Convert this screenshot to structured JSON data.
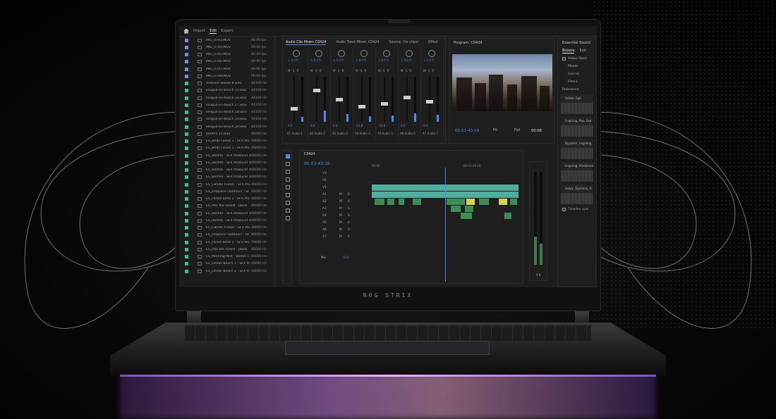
{
  "nav": {
    "import": "Import",
    "edit": "Edit",
    "export": "Export"
  },
  "project_items": [
    {
      "name": "IMG_0743.MOV",
      "rate": "60.00 fps",
      "color": "#7b8bd4",
      "kind": "video"
    },
    {
      "name": "IMG_0744.MOV",
      "rate": "60.00 fps",
      "color": "#7b8bd4",
      "kind": "video"
    },
    {
      "name": "IMG_0745.MOV",
      "rate": "60.00 fps",
      "color": "#7b8bd4",
      "kind": "video"
    },
    {
      "name": "IMG_0746.MOV",
      "rate": "60.00 fps",
      "color": "#7b8bd4",
      "kind": "video"
    },
    {
      "name": "IMG_0747.MOV",
      "rate": "60.00 fps",
      "color": "#7b8bd4",
      "kind": "video"
    },
    {
      "name": "IMG_0748.MOV",
      "rate": "60.00 fps",
      "color": "#7b8bd4",
      "kind": "video"
    },
    {
      "name": "ambient waves 8.wav",
      "rate": "44100 Hz",
      "color": "#37c08a",
      "kind": "audio"
    },
    {
      "name": "seagull-on-beach 15.wav",
      "rate": "44100 Hz",
      "color": "#37c08a",
      "kind": "audio"
    },
    {
      "name": "seagull-on-beach 16.wav",
      "rate": "44100 Hz",
      "color": "#37c08a",
      "kind": "audio"
    },
    {
      "name": "seagull-on-beach 17.wav",
      "rate": "44100 Hz",
      "color": "#37c08a",
      "kind": "audio"
    },
    {
      "name": "seagull-on-beach 18.wav",
      "rate": "44100 Hz",
      "color": "#37c08a",
      "kind": "audio"
    },
    {
      "name": "seagull-on-beach 19.wav",
      "rate": "44100 Hz",
      "color": "#37c08a",
      "kind": "audio"
    },
    {
      "name": "seagull-on-beach 20.wav",
      "rate": "44100 Hz",
      "color": "#37c08a",
      "kind": "audio"
    },
    {
      "name": "bonfire 12.wav",
      "rate": "48000 Hz",
      "color": "#37c08a",
      "kind": "audio"
    },
    {
      "name": "ES_Birds Forest 1 - SFX Pro",
      "rate": "48000 Hz",
      "color": "#37c08a",
      "kind": "audio"
    },
    {
      "name": "ES_Birds Forest 1 - SFX Pro",
      "rate": "48000 Hz",
      "color": "#37c08a",
      "kind": "audio"
    },
    {
      "name": "ES_Bonfire - SFX Producer 4",
      "rate": "48000 Hz",
      "color": "#37c08a",
      "kind": "audio"
    },
    {
      "name": "ES_Bonfire - SFX Producer 4",
      "rate": "48000 Hz",
      "color": "#37c08a",
      "kind": "audio"
    },
    {
      "name": "ES_Bonfire - SFX Producer 4",
      "rate": "48000 Hz",
      "color": "#37c08a",
      "kind": "audio"
    },
    {
      "name": "ES_Bonfire - SFX Producer 4",
      "rate": "48000 Hz",
      "color": "#37c08a",
      "kind": "audio"
    },
    {
      "name": "ES_Candle Flicker - SFX Pro",
      "rate": "48000 Hz",
      "color": "#37c08a",
      "kind": "audio"
    },
    {
      "name": "ES_Fireplace Outdoors - SF",
      "rate": "48000 Hz",
      "color": "#37c08a",
      "kind": "audio"
    },
    {
      "name": "ES_Forest Birds 2 - SFX Pro",
      "rate": "48000 Hz",
      "color": "#37c08a",
      "kind": "audio"
    },
    {
      "name": "ES_Into the Forest - Jakob",
      "rate": "48000 Hz",
      "color": "#37c08a",
      "kind": "audio"
    },
    {
      "name": "ES_Bonfire - SFX Producer 4",
      "rate": "48000 Hz",
      "color": "#37c08a",
      "kind": "audio"
    },
    {
      "name": "ES_Bonfire - SFX Producer 4",
      "rate": "48000 Hz",
      "color": "#37c08a",
      "kind": "audio"
    },
    {
      "name": "ES_Candle Flicker - SFX Pro",
      "rate": "48000 Hz",
      "color": "#37c08a",
      "kind": "audio"
    },
    {
      "name": "ES_Fireplace Outdoors - SF",
      "rate": "48000 Hz",
      "color": "#37c08a",
      "kind": "audio"
    },
    {
      "name": "ES_Forest Birds 2 - SFX Pro",
      "rate": "48000 Hz",
      "color": "#37c08a",
      "kind": "audio"
    },
    {
      "name": "ES_Into the Forest - Jakob",
      "rate": "48000 Hz",
      "color": "#37c08a",
      "kind": "audio"
    },
    {
      "name": "ES_Morning Mist - Stefan C",
      "rate": "48000 Hz",
      "color": "#37c08a",
      "kind": "audio"
    },
    {
      "name": "ES_Ocean Beach 1 - SFX Pr",
      "rate": "48000 Hz",
      "color": "#37c08a",
      "kind": "audio"
    },
    {
      "name": "ES_Ocean Beach 2 - SFX Pr",
      "rate": "48000 Hz",
      "color": "#37c08a",
      "kind": "audio"
    }
  ],
  "mixer": {
    "tabs": [
      "Audio Clip Mixer: C0424",
      "Audio Track Mixer: C0424",
      "Source: (no clips)",
      "Effect"
    ],
    "channels": [
      {
        "lr": "L  0.0  R",
        "value": "0.0",
        "label": "A1  Audio 1",
        "level": 0.3
      },
      {
        "lr": "L  0.0  R",
        "value": "0.0",
        "label": "A2  Audio 2",
        "level": 0.7
      },
      {
        "lr": "L  0.0  R",
        "value": "0.0",
        "label": "A3  Audio 3",
        "level": 0.5
      },
      {
        "lr": "L  0.0  R",
        "value": "-11.8",
        "label": "A4  Audio 4",
        "level": 0.35
      },
      {
        "lr": "L  0.0  R",
        "value": "-10.9",
        "label": "A5  Audio 5",
        "level": 0.4
      },
      {
        "lr": "L  0.0  R",
        "value": "0.0",
        "label": "A6  Audio 6",
        "level": 0.55
      },
      {
        "lr": "L  0.0  R",
        "value": "0.0",
        "label": "A7  Audio 7",
        "level": 0.45
      }
    ],
    "msr": "M S R"
  },
  "program": {
    "title": "Program: C0424",
    "timecode": "00:03:43:19",
    "fit": "Fit",
    "full": "Full",
    "duration": "00:08"
  },
  "essential_sound": {
    "title": "Essential Sound",
    "tabs": [
      "Browse",
      "Edit"
    ],
    "adobe_stock": "Adobe Stock",
    "rows": [
      "Moods",
      "Genres",
      "Filters"
    ],
    "sort": "Relevance",
    "presets": [
      "Action, Epic",
      "Inspiring, Pop, Sad",
      "Dynamic, Inspiring",
      "Inspiring, Emotional",
      "Angry, Dynamic, H"
    ],
    "timeline_sync": "Timeline sync"
  },
  "timeline": {
    "title": "C0424",
    "timecode": "00:03:43:19",
    "ruler_start": "00:00",
    "ruler_mid": "00:03:49:16",
    "tracks": [
      {
        "label": "V3",
        "m": "",
        "s": ""
      },
      {
        "label": "V2",
        "m": "",
        "s": ""
      },
      {
        "label": "V1",
        "m": "",
        "s": ""
      },
      {
        "label": "A1",
        "m": "M",
        "s": "S"
      },
      {
        "label": "A2",
        "m": "M",
        "s": "S"
      },
      {
        "label": "A3",
        "m": "M",
        "s": "S"
      },
      {
        "label": "A4",
        "m": "M",
        "s": "S"
      },
      {
        "label": "A5",
        "m": "M",
        "s": "S"
      },
      {
        "label": "A6",
        "m": "M",
        "s": "S"
      },
      {
        "label": "A7",
        "m": "M",
        "s": "S"
      }
    ],
    "master_label": "Mix",
    "master_value": "0.0"
  },
  "meter_labels": "S  S",
  "device": {
    "brand": "ROG STRIX"
  },
  "colors": {
    "accent": "#4b8cf2",
    "audio_clip": "#3b8c55",
    "video_clip": "#4fae9d",
    "highlight_clip": "#d7d24a"
  }
}
